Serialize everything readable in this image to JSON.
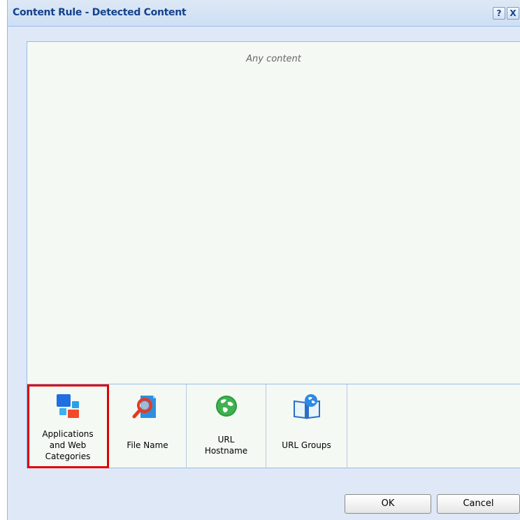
{
  "dialog": {
    "title": "Content Rule - Detected Content",
    "help_glyph": "?",
    "close_glyph": "X"
  },
  "panel": {
    "placeholder": "Any content"
  },
  "palette": {
    "items": [
      {
        "label": "Applications and Web Categories",
        "lines": [
          "Applications",
          "and Web",
          "Categories"
        ],
        "icon": "applications-icon",
        "selected": true
      },
      {
        "label": "File Name",
        "lines": [
          "File Name"
        ],
        "icon": "file-name-icon",
        "selected": false
      },
      {
        "label": "URL Hostname",
        "lines": [
          "URL",
          "Hostname"
        ],
        "icon": "globe-icon",
        "selected": false
      },
      {
        "label": "URL Groups",
        "lines": [
          "URL Groups"
        ],
        "icon": "book-globe-icon",
        "selected": false
      }
    ]
  },
  "footer": {
    "ok_label": "OK",
    "cancel_label": "Cancel"
  },
  "colors": {
    "title_text": "#15428b",
    "dialog_bg": "#dfe8f6",
    "panel_bg": "#f4f9f4",
    "border": "#99bbe8",
    "selection": "#e00000"
  }
}
